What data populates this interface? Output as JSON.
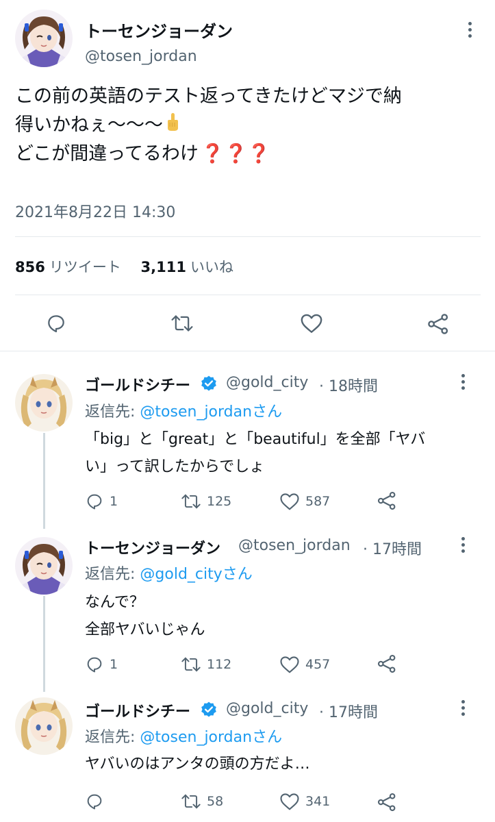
{
  "main": {
    "author_name": "トーセンジョーダン",
    "author_handle": "@tosen_jordan",
    "text_line1": "この前の英語のテスト返ってきたけどマジで納",
    "text_line2": "得いかねぇ〜〜〜",
    "text_line3": "どこが間違ってるわけ",
    "emoji_q": "❓❓❓",
    "timestamp": "2021年8月22日 14:30",
    "retweet_count": "856",
    "retweet_label": "リツイート",
    "like_count": "3,111",
    "like_label": "いいね"
  },
  "replies": [
    {
      "name": "ゴールドシチー",
      "handle": "@gold_city",
      "time": "· 18時間",
      "reply_prefix": "返信先:",
      "reply_mention": "@tosen_jordanさん",
      "lines": [
        "「big」と「great」と「beautiful」を全部「ヤバ",
        "い」って訳したからでしょ"
      ],
      "replies": "1",
      "retweets": "125",
      "likes": "587"
    },
    {
      "name": "トーセンジョーダン",
      "handle": "@tosen_jordan",
      "time": "· 17時間",
      "reply_prefix": "返信先:",
      "reply_mention": "@gold_cityさん",
      "lines": [
        "なんで？",
        "全部ヤバいじゃん"
      ],
      "replies": "1",
      "retweets": "112",
      "likes": "457"
    },
    {
      "name": "ゴールドシチー",
      "handle": "@gold_city",
      "time": "· 17時間",
      "reply_prefix": "返信先:",
      "reply_mention": "@tosen_jordanさん",
      "lines": [
        "ヤバいのはアンタの頭の方だよ…"
      ],
      "replies": "",
      "retweets": "58",
      "likes": "341"
    }
  ],
  "colors": {
    "accent": "#1d9bf0",
    "text": "#0f1419",
    "muted": "#536471",
    "divider": "#e5e9ec"
  },
  "icons": [
    "reply-icon",
    "retweet-icon",
    "like-icon",
    "share-icon",
    "more-icon",
    "verified-icon",
    "middle-finger-emoji"
  ]
}
